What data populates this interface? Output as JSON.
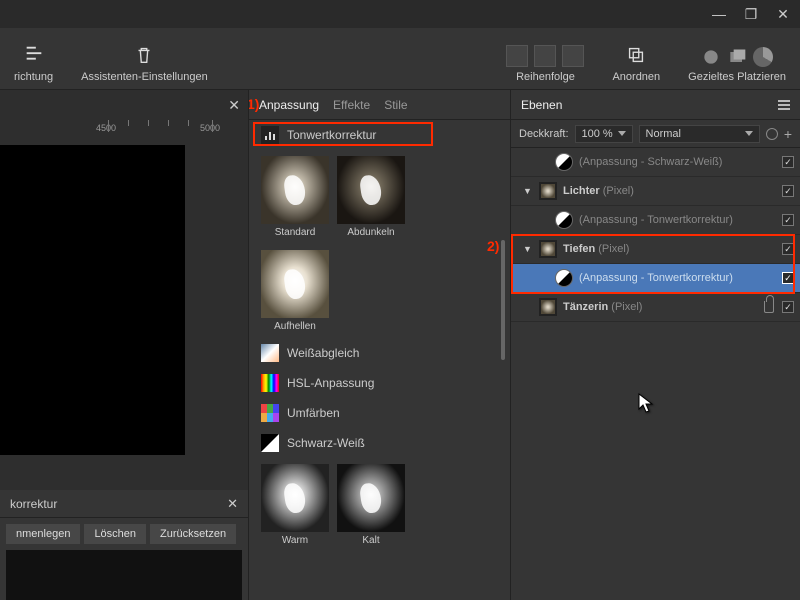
{
  "window": {
    "min": "—",
    "max": "❐",
    "close": "✕"
  },
  "toolbar": {
    "align": "richtung",
    "wizard": "Assistenten-Einstellungen",
    "order": "Reihenfolge",
    "arrange": "Anordnen",
    "place": "Gezieltes Platzieren"
  },
  "ruler": {
    "t1": "4500",
    "t2": "5000"
  },
  "mid": {
    "tabs": {
      "adjust": "Anpassung",
      "effects": "Effekte",
      "styles": "Stile"
    },
    "items": {
      "levels": "Tonwertkorrektur",
      "wb": "Weißabgleich",
      "hsl": "HSL-Anpassung",
      "recolor": "Umfärben",
      "bw": "Schwarz-Weiß"
    },
    "presets": {
      "standard": "Standard",
      "darken": "Abdunkeln",
      "brighten": "Aufhellen",
      "warm": "Warm",
      "cold": "Kalt"
    }
  },
  "right": {
    "panel": "Ebenen",
    "opacityLabel": "Deckkraft:",
    "opacityValue": "100 %",
    "blend": "Normal",
    "layers": {
      "adjBW": "(Anpassung - Schwarz-Weiß)",
      "lights": "Lichter",
      "pixel": "(Pixel)",
      "adjLevels": "(Anpassung - Tonwertkorrektur)",
      "depths": "Tiefen",
      "dancer": "Tänzerin"
    },
    "check": "✓"
  },
  "bottom": {
    "title": "korrektur",
    "merge": "nmenlegen",
    "delete": "Löschen",
    "reset": "Zurücksetzen"
  },
  "annot": {
    "one": "1)",
    "two": "2)"
  }
}
